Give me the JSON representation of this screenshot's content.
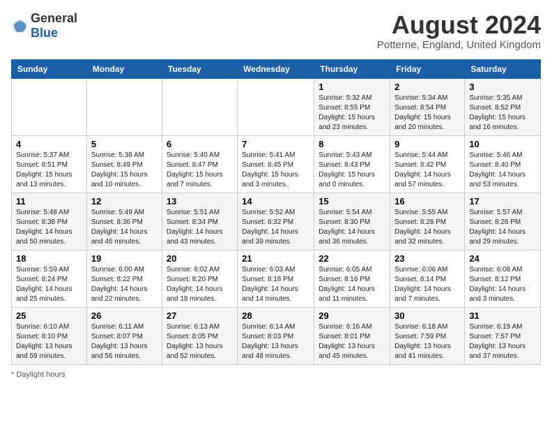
{
  "logo": {
    "general": "General",
    "blue": "Blue"
  },
  "header": {
    "month": "August 2024",
    "location": "Potterne, England, United Kingdom"
  },
  "weekdays": [
    "Sunday",
    "Monday",
    "Tuesday",
    "Wednesday",
    "Thursday",
    "Friday",
    "Saturday"
  ],
  "weeks": [
    [
      {
        "day": "",
        "info": ""
      },
      {
        "day": "",
        "info": ""
      },
      {
        "day": "",
        "info": ""
      },
      {
        "day": "",
        "info": ""
      },
      {
        "day": "1",
        "info": "Sunrise: 5:32 AM\nSunset: 8:55 PM\nDaylight: 15 hours\nand 23 minutes."
      },
      {
        "day": "2",
        "info": "Sunrise: 5:34 AM\nSunset: 8:54 PM\nDaylight: 15 hours\nand 20 minutes."
      },
      {
        "day": "3",
        "info": "Sunrise: 5:35 AM\nSunset: 8:52 PM\nDaylight: 15 hours\nand 16 minutes."
      }
    ],
    [
      {
        "day": "4",
        "info": "Sunrise: 5:37 AM\nSunset: 8:51 PM\nDaylight: 15 hours\nand 13 minutes."
      },
      {
        "day": "5",
        "info": "Sunrise: 5:38 AM\nSunset: 8:49 PM\nDaylight: 15 hours\nand 10 minutes."
      },
      {
        "day": "6",
        "info": "Sunrise: 5:40 AM\nSunset: 8:47 PM\nDaylight: 15 hours\nand 7 minutes."
      },
      {
        "day": "7",
        "info": "Sunrise: 5:41 AM\nSunset: 8:45 PM\nDaylight: 15 hours\nand 3 minutes."
      },
      {
        "day": "8",
        "info": "Sunrise: 5:43 AM\nSunset: 8:43 PM\nDaylight: 15 hours\nand 0 minutes."
      },
      {
        "day": "9",
        "info": "Sunrise: 5:44 AM\nSunset: 8:42 PM\nDaylight: 14 hours\nand 57 minutes."
      },
      {
        "day": "10",
        "info": "Sunrise: 5:46 AM\nSunset: 8:40 PM\nDaylight: 14 hours\nand 53 minutes."
      }
    ],
    [
      {
        "day": "11",
        "info": "Sunrise: 5:48 AM\nSunset: 8:38 PM\nDaylight: 14 hours\nand 50 minutes."
      },
      {
        "day": "12",
        "info": "Sunrise: 5:49 AM\nSunset: 8:36 PM\nDaylight: 14 hours\nand 46 minutes."
      },
      {
        "day": "13",
        "info": "Sunrise: 5:51 AM\nSunset: 8:34 PM\nDaylight: 14 hours\nand 43 minutes."
      },
      {
        "day": "14",
        "info": "Sunrise: 5:52 AM\nSunset: 8:32 PM\nDaylight: 14 hours\nand 39 minutes."
      },
      {
        "day": "15",
        "info": "Sunrise: 5:54 AM\nSunset: 8:30 PM\nDaylight: 14 hours\nand 36 minutes."
      },
      {
        "day": "16",
        "info": "Sunrise: 5:55 AM\nSunset: 8:28 PM\nDaylight: 14 hours\nand 32 minutes."
      },
      {
        "day": "17",
        "info": "Sunrise: 5:57 AM\nSunset: 8:26 PM\nDaylight: 14 hours\nand 29 minutes."
      }
    ],
    [
      {
        "day": "18",
        "info": "Sunrise: 5:59 AM\nSunset: 8:24 PM\nDaylight: 14 hours\nand 25 minutes."
      },
      {
        "day": "19",
        "info": "Sunrise: 6:00 AM\nSunset: 8:22 PM\nDaylight: 14 hours\nand 22 minutes."
      },
      {
        "day": "20",
        "info": "Sunrise: 6:02 AM\nSunset: 8:20 PM\nDaylight: 14 hours\nand 18 minutes."
      },
      {
        "day": "21",
        "info": "Sunrise: 6:03 AM\nSunset: 8:18 PM\nDaylight: 14 hours\nand 14 minutes."
      },
      {
        "day": "22",
        "info": "Sunrise: 6:05 AM\nSunset: 8:16 PM\nDaylight: 14 hours\nand 11 minutes."
      },
      {
        "day": "23",
        "info": "Sunrise: 6:06 AM\nSunset: 8:14 PM\nDaylight: 14 hours\nand 7 minutes."
      },
      {
        "day": "24",
        "info": "Sunrise: 6:08 AM\nSunset: 8:12 PM\nDaylight: 14 hours\nand 3 minutes."
      }
    ],
    [
      {
        "day": "25",
        "info": "Sunrise: 6:10 AM\nSunset: 8:10 PM\nDaylight: 13 hours\nand 59 minutes."
      },
      {
        "day": "26",
        "info": "Sunrise: 6:11 AM\nSunset: 8:07 PM\nDaylight: 13 hours\nand 56 minutes."
      },
      {
        "day": "27",
        "info": "Sunrise: 6:13 AM\nSunset: 8:05 PM\nDaylight: 13 hours\nand 52 minutes."
      },
      {
        "day": "28",
        "info": "Sunrise: 6:14 AM\nSunset: 8:03 PM\nDaylight: 13 hours\nand 48 minutes."
      },
      {
        "day": "29",
        "info": "Sunrise: 6:16 AM\nSunset: 8:01 PM\nDaylight: 13 hours\nand 45 minutes."
      },
      {
        "day": "30",
        "info": "Sunrise: 6:18 AM\nSunset: 7:59 PM\nDaylight: 13 hours\nand 41 minutes."
      },
      {
        "day": "31",
        "info": "Sunrise: 6:19 AM\nSunset: 7:57 PM\nDaylight: 13 hours\nand 37 minutes."
      }
    ]
  ],
  "footer": {
    "note": "Daylight hours"
  }
}
